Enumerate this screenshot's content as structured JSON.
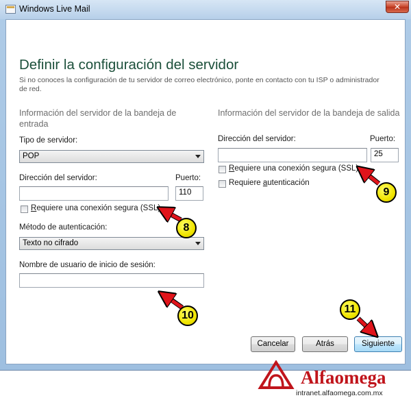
{
  "window": {
    "title": "Windows Live Mail",
    "close_label": "✕"
  },
  "page": {
    "heading": "Definir la configuración del servidor",
    "subtext": "Si no conoces la configuración de tu servidor de correo electrónico, ponte en contacto con tu ISP o administrador de red."
  },
  "incoming": {
    "section_title": "Información del servidor de la bandeja de entrada",
    "server_type_label": "Tipo de servidor:",
    "server_type_value": "POP",
    "address_label": "Dirección del servidor:",
    "address_value": "",
    "port_label": "Puerto:",
    "port_value": "110",
    "ssl_label_pre": "",
    "ssl_label_key": "R",
    "ssl_label_post": "equiere una conexión segura (SSL)",
    "ssl_checked": false,
    "auth_method_label": "Método de autenticación:",
    "auth_method_value": "Texto no cifrado",
    "username_label": "Nombre de usuario de inicio de sesión:",
    "username_value": ""
  },
  "outgoing": {
    "section_title": "Información del servidor de la bandeja de salida",
    "address_label": "Dirección del servidor:",
    "address_value": "",
    "port_label": "Puerto:",
    "port_value": "25",
    "ssl_label_pre": "",
    "ssl_label_key": "R",
    "ssl_label_post": "equiere una conexión segura (SSL)",
    "ssl_checked": false,
    "auth_label_pre": "Requiere ",
    "auth_label_key": "a",
    "auth_label_post": "utenticación",
    "auth_checked": false
  },
  "buttons": {
    "cancel": "Cancelar",
    "back": "Atrás",
    "next": "Siguiente"
  },
  "annotations": {
    "callout_8": "8",
    "callout_9": "9",
    "callout_10": "10",
    "callout_11": "11",
    "color_fill": "#f0e400",
    "color_arrow": "#e0141b"
  },
  "brand": {
    "name": "Alfaomega",
    "url": "intranet.alfaomega.com.mx",
    "color": "#c0141b"
  }
}
